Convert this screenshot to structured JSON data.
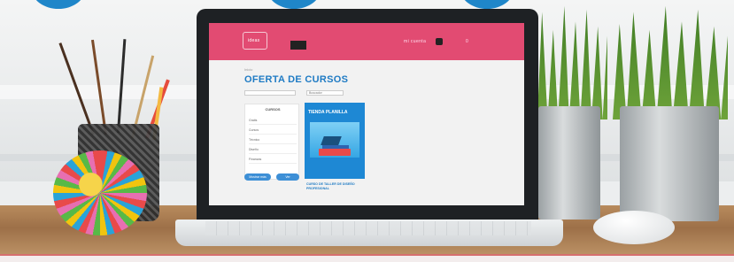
{
  "scene": {
    "description_objects": [
      "brush-cup",
      "yarn-ball",
      "laptop",
      "plants",
      "mouse"
    ]
  },
  "laptop_site": {
    "logo_text": "ideas",
    "header_small_1": "mi cuenta",
    "header_small_2": "0",
    "breadcrumb": "Inicio",
    "page_title": "OFERTA DE CURSOS",
    "select_1": "",
    "select_2": "Buscador",
    "filter": {
      "title": "CURSOS",
      "rows": [
        "Gratis",
        "Cursos",
        "Técnico",
        "Diseño",
        "Finanzas"
      ]
    },
    "buttons": [
      "Mostrar más",
      "Ver"
    ],
    "card": {
      "tag": "TIENDA PLANILLA",
      "title": "CURSO DE TALLER DE DISEÑO PROFESIONAL"
    }
  },
  "colors": {
    "site_header": "#e24b72",
    "site_accent": "#1f7bc4",
    "circle_accent": "#1f86c9"
  }
}
